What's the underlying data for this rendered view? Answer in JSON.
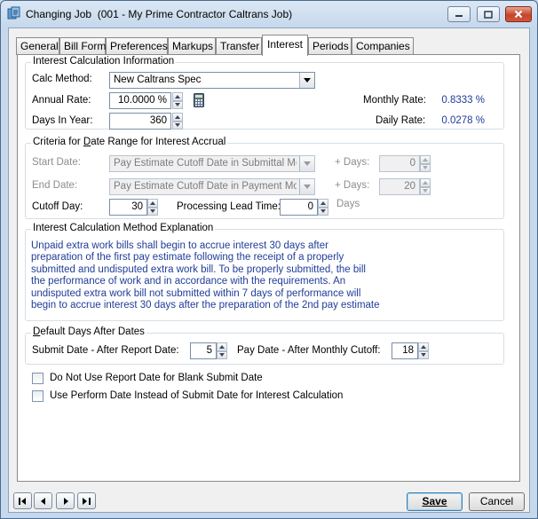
{
  "window": {
    "title": "Changing Job  (001 - My Prime Contractor Caltrans Job)"
  },
  "tabs": [
    {
      "label": "General"
    },
    {
      "label": "Bill Form"
    },
    {
      "label": "Preferences"
    },
    {
      "label": "Markups"
    },
    {
      "label": "Transfer"
    },
    {
      "label": "Interest"
    },
    {
      "label": "Periods"
    },
    {
      "label": "Companies"
    }
  ],
  "interest_calc": {
    "group_title": "Interest Calculation Information",
    "calc_method_label": "Calc Method:",
    "calc_method_value": "New Caltrans Spec",
    "annual_rate_label": "Annual Rate:",
    "annual_rate_value": "10.0000 %",
    "days_in_year_label": "Days In Year:",
    "days_in_year_value": "360",
    "monthly_rate_label": "Monthly Rate:",
    "monthly_rate_value": "0.8333 %",
    "daily_rate_label": "Daily Rate:",
    "daily_rate_value": "0.0278 %"
  },
  "date_range": {
    "group_title_pre": "Criteria for ",
    "group_title_key": "D",
    "group_title_post": "ate Range for Interest Accrual",
    "start_date_label": "Start Date:",
    "start_date_value": "Pay Estimate Cutoff Date in Submittal Mo",
    "start_plus_days_label": "+ Days:",
    "start_plus_days_value": "0",
    "end_date_label": "End Date:",
    "end_date_value": "Pay Estimate Cutoff Date in Payment Mo",
    "end_plus_days_label": "+ Days:",
    "end_plus_days_value": "20",
    "cutoff_day_label": "Cutoff Day:",
    "cutoff_day_value": "30",
    "lead_time_label": "Processing Lead Time:",
    "lead_time_value": "0",
    "lead_time_unit": "Days"
  },
  "explanation": {
    "group_title": "Interest Calculation Method Explanation",
    "text": "Unpaid extra work bills shall begin to accrue interest 30 days after\npreparation of the first pay estimate following the receipt of a properly\nsubmitted and undisputed extra work bill. To be properly submitted, the bill\nthe performance of work and in accordance with the requirements. An\nundisputed extra work bill not submitted within 7 days of performance will\nbegin to accrue interest 30 days after the preparation of the 2nd pay estimate"
  },
  "default_days": {
    "group_title_key": "D",
    "group_title_rest": "efault Days After Dates",
    "submit_label": "Submit Date - After Report Date:",
    "submit_value": "5",
    "pay_label": "Pay Date - After Monthly Cutoff:",
    "pay_value": "18"
  },
  "options": {
    "no_report_date_label": "Do Not Use Report Date for Blank Submit Date",
    "perform_date_label": "Use Perform Date Instead of Submit Date for Interest Calculation"
  },
  "buttons": {
    "save_label": "Save",
    "cancel_label": "Cancel"
  },
  "colors": {
    "value_blue": "#1f3d99",
    "default_button_border": "#3c7fb1"
  }
}
